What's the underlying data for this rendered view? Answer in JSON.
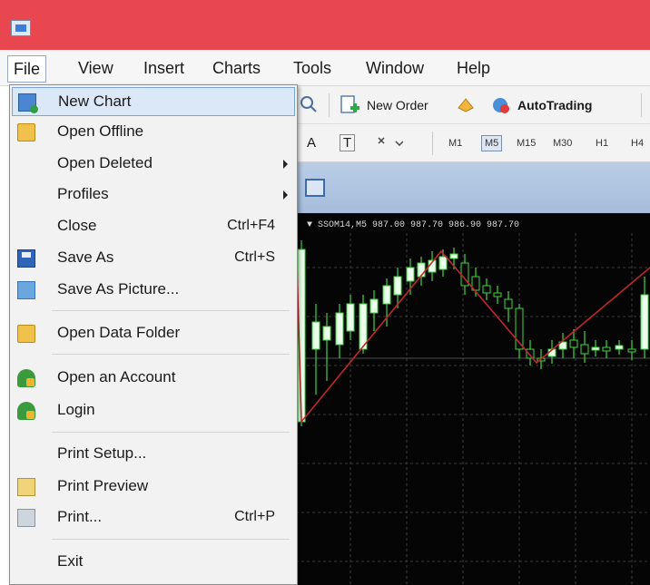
{
  "menubar": {
    "items": [
      "File",
      "View",
      "Insert",
      "Charts",
      "Tools",
      "Window",
      "Help"
    ]
  },
  "toolbar": {
    "new_order": "New Order",
    "autotrading": "AutoTrading",
    "text_tool": "A",
    "label_tool": "T",
    "timeframes": [
      "M1",
      "M5",
      "M15",
      "M30",
      "H1",
      "H4"
    ]
  },
  "chart": {
    "header": "▼ SSOM14,M5  987.00  987.70  986.90  987.70"
  },
  "file_menu": {
    "items": [
      {
        "label": "New Chart",
        "icon": "new-chart-icon",
        "highlighted": true
      },
      {
        "label": "Open Offline",
        "icon": "open-folder-icon"
      },
      {
        "label": "Open Deleted",
        "submenu": true
      },
      {
        "label": "Profiles",
        "submenu": true
      },
      {
        "label": "Close",
        "shortcut": "Ctrl+F4"
      },
      {
        "label": "Save As",
        "shortcut": "Ctrl+S",
        "icon": "save-icon"
      },
      {
        "label": "Save As Picture...",
        "icon": "picture-icon"
      },
      {
        "label": "Open Data Folder",
        "icon": "folder-icon"
      },
      {
        "label": "Open an Account",
        "icon": "account-icon"
      },
      {
        "label": "Login",
        "icon": "login-icon"
      },
      {
        "label": "Print Setup..."
      },
      {
        "label": "Print Preview",
        "icon": "print-preview-icon"
      },
      {
        "label": "Print...",
        "shortcut": "Ctrl+P",
        "icon": "printer-icon"
      },
      {
        "label": "Exit"
      }
    ]
  },
  "colors": {
    "titlebar": "#e8474f",
    "menu_highlight": "#dbe8f8",
    "chart_background": "#050505",
    "bull_candle": "#3fd43f",
    "zigzag": "#c0282b"
  }
}
